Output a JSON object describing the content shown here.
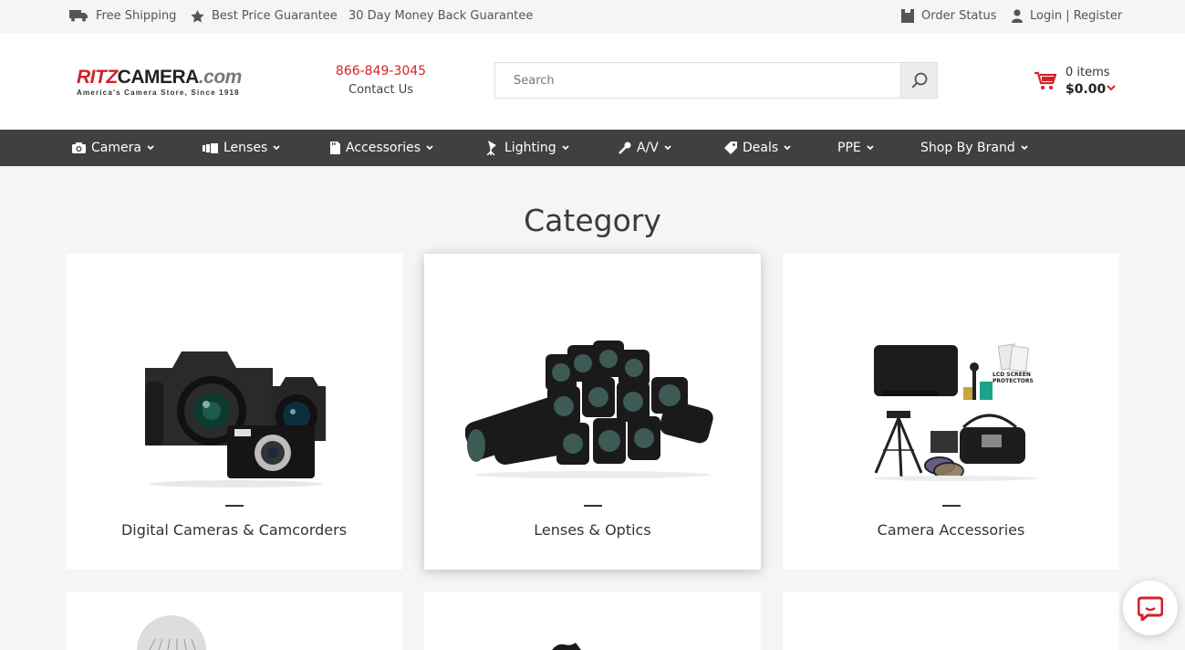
{
  "topbar": {
    "free_shipping": "Free Shipping",
    "best_price": "Best Price Guarantee",
    "money_back": "30 Day Money Back Guarantee",
    "order_status": "Order Status",
    "login_register": "Login | Register"
  },
  "header": {
    "logo": {
      "brand": "RITZ",
      "word": "CAMERA",
      "tld": ".com",
      "tagline": "America's Camera Store, Since 1918"
    },
    "phone": "866-849-3045",
    "contact": "Contact Us",
    "search": {
      "placeholder": "Search",
      "value": ""
    },
    "cart": {
      "items": "0 items",
      "total": "$0.00"
    }
  },
  "nav": [
    {
      "label": "Camera",
      "icon": "camera-icon"
    },
    {
      "label": "Lenses",
      "icon": "lens-icon"
    },
    {
      "label": "Accessories",
      "icon": "sd-card-icon"
    },
    {
      "label": "Lighting",
      "icon": "light-icon"
    },
    {
      "label": "A/V",
      "icon": "microphone-icon"
    },
    {
      "label": "Deals",
      "icon": "tag-icon"
    },
    {
      "label": "PPE",
      "icon": ""
    },
    {
      "label": "Shop By Brand",
      "icon": ""
    }
  ],
  "main": {
    "title": "Category",
    "categories": [
      {
        "label": "Digital Cameras & Camcorders",
        "image": "cameras-image"
      },
      {
        "label": "Lenses & Optics",
        "image": "lenses-image"
      },
      {
        "label": "Camera Accessories",
        "image": "accessories-image"
      }
    ]
  },
  "colors": {
    "accent": "#d2232a",
    "nav_bg": "#404040",
    "page_bg": "#f5f5f5"
  }
}
